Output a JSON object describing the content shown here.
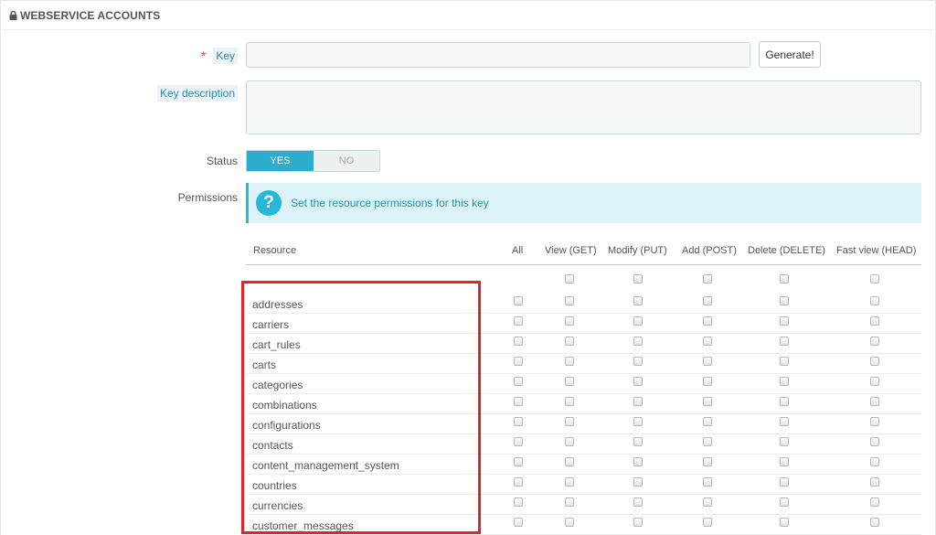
{
  "panel": {
    "title": "WEBSERVICE ACCOUNTS",
    "icon": "lock-icon"
  },
  "form": {
    "key_label": "Key",
    "key_required_mark": "*",
    "key_value": "",
    "generate_button": "Generate!",
    "description_label": "Key description",
    "description_value": "",
    "status_label": "Status",
    "status_yes": "YES",
    "status_no": "NO",
    "status_selected": "YES",
    "permissions_label": "Permissions"
  },
  "alert": {
    "text": "Set the resource permissions for this key",
    "icon": "question-circle-icon"
  },
  "table": {
    "columns": [
      "Resource",
      "All",
      "View (GET)",
      "Modify (PUT)",
      "Add (POST)",
      "Delete (DELETE)",
      "Fast view (HEAD)"
    ],
    "rows": [
      "addresses",
      "carriers",
      "cart_rules",
      "carts",
      "categories",
      "combinations",
      "configurations",
      "contacts",
      "content_management_system",
      "countries",
      "currencies",
      "customer_messages"
    ]
  },
  "colors": {
    "accent": "#25b9d7",
    "switch_on": "#2eacce",
    "highlight_box": "#e3232c",
    "required": "#e0313b"
  }
}
